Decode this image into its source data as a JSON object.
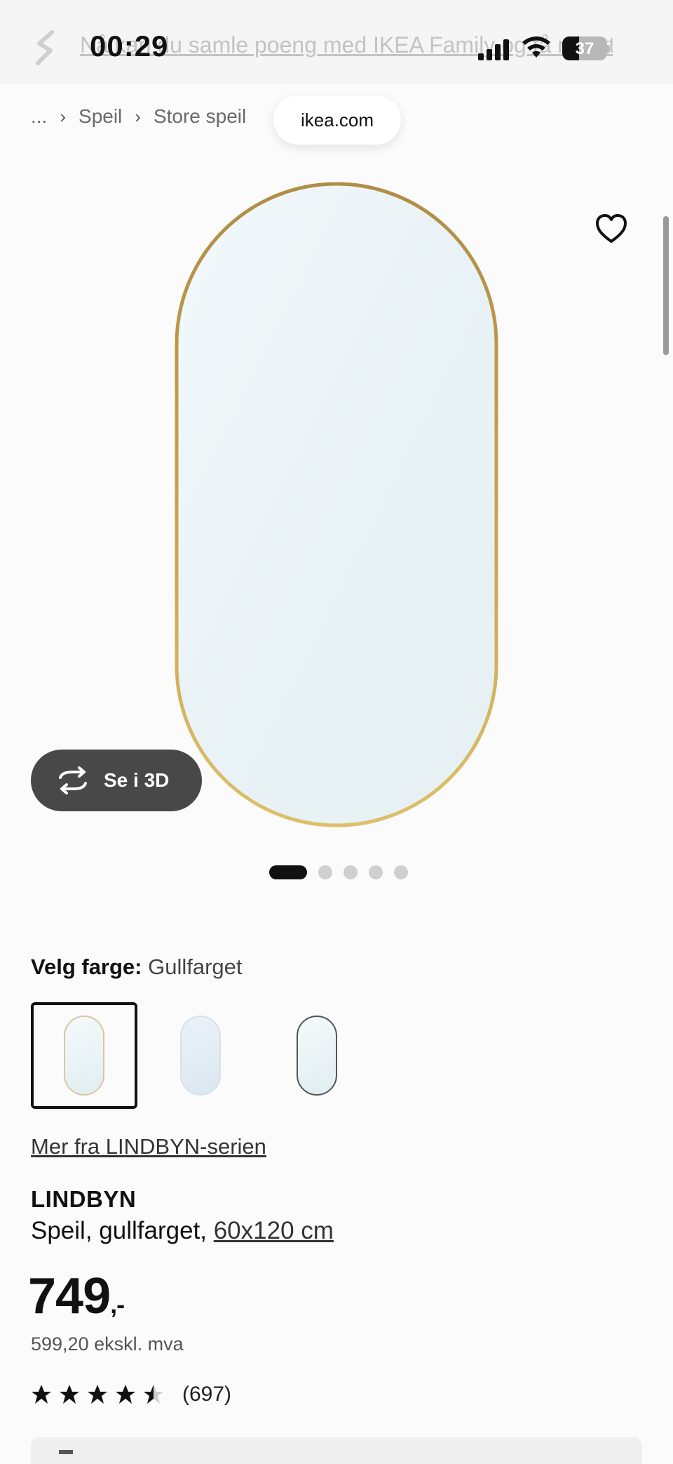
{
  "status_bar": {
    "time": "00:29",
    "battery": "37",
    "battery_level": 0.37
  },
  "promo": {
    "text": "Nå kan du samle poeng med IKEA Family og få rabatt"
  },
  "browser": {
    "url_label": "ikea.com"
  },
  "breadcrumb": {
    "ellipsis": "...",
    "items": [
      "Speil",
      "Store speil"
    ]
  },
  "gallery": {
    "button_3d": "Se i 3D",
    "slide_count": 5,
    "active_slide": 1
  },
  "color_select": {
    "label": "Velg farge:",
    "value": "Gullfarget",
    "options": [
      "gold-frame",
      "no-frame",
      "black-frame"
    ],
    "selected": 0
  },
  "series_link": "Mer fra LINDBYN-serien",
  "product": {
    "brand": "LINDBYN",
    "description": "Speil, gullfarget, ",
    "size": "60x120 cm",
    "price": "749",
    "price_suffix": ",-",
    "price_ex_vat": "599,20 ekskl. mva",
    "rating": 4.5,
    "rating_count": "(697)"
  },
  "colors": {
    "gold": "#c8a654",
    "pill_dark": "#484848"
  }
}
